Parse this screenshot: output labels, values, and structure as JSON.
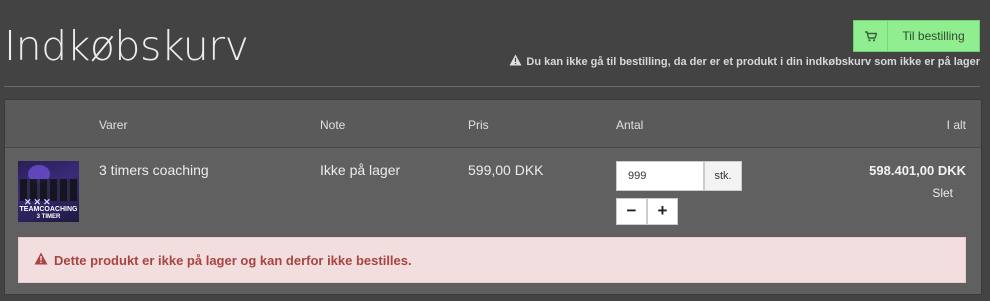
{
  "page": {
    "title": "Indkøbskurv"
  },
  "checkout": {
    "label": "Til bestilling",
    "icon": "cart-icon"
  },
  "notice": {
    "text": "Du kan ikke gå til bestilling, da der er et produkt i din indkøbskurv som ikke er på lager",
    "icon": "warning-icon"
  },
  "table": {
    "headers": {
      "items": "Varer",
      "note": "Note",
      "price": "Pris",
      "quantity": "Antal",
      "total": "I alt"
    },
    "rows": [
      {
        "thumbnail": {
          "mark": "✕✕✕",
          "line1": "TEAMCOACHING",
          "line2": "3 TIMER"
        },
        "name": "3 timers coaching",
        "note": "Ikke på lager",
        "price": "599,00 DKK",
        "quantity": "999",
        "unit": "stk.",
        "decrement": "−",
        "increment": "+",
        "total": "598.401,00 DKK",
        "delete": "Slet",
        "alert": "Dette produkt er ikke på lager og kan derfor ikke bestilles."
      }
    ]
  },
  "colors": {
    "accent": "#90ee90",
    "alert_bg": "#f2dede",
    "alert_text": "#a94442",
    "background": "#434343"
  }
}
